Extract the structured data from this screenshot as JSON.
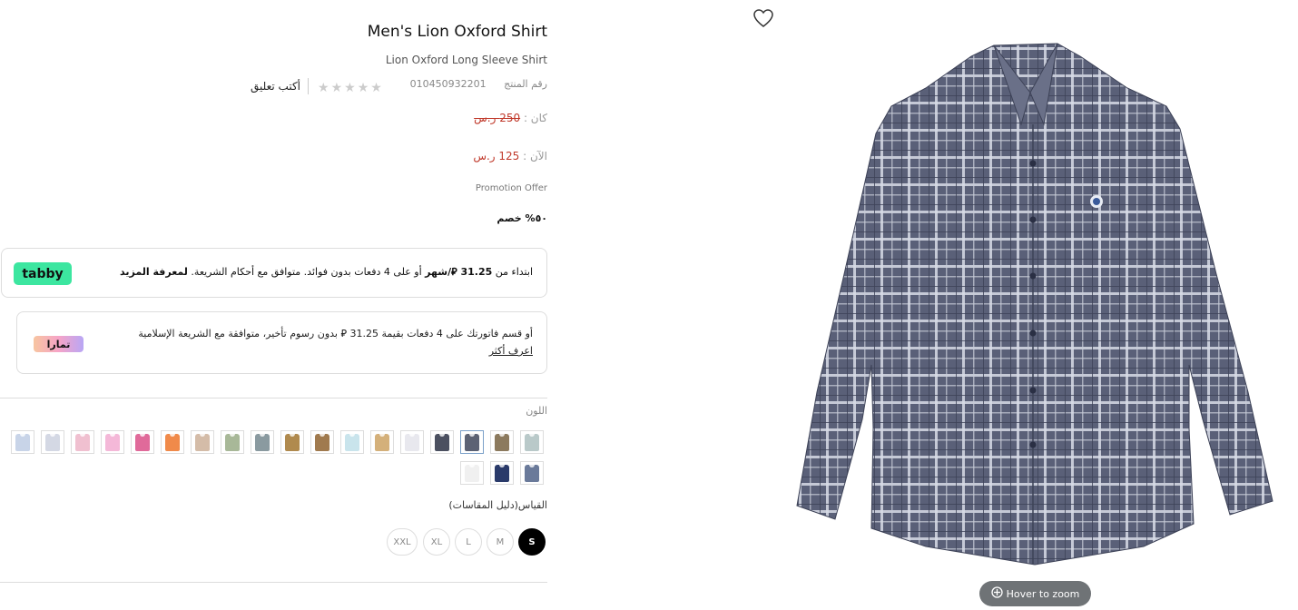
{
  "product": {
    "title": "Men's Lion Oxford Shirt",
    "subtitle": "Lion Oxford Long Sleeve Shirt",
    "sku_label": "رقم المنتج",
    "sku": "010450932201",
    "write_review": "أكتب تعليق",
    "rating": 0,
    "rating_max": 5
  },
  "pricing": {
    "was_label": "كان :",
    "was_price": "250 ر.س",
    "now_label": "الآن :",
    "now_price": "125 ر.س",
    "promo_label": "Promotion Offer",
    "discount": "٥٠% خصم"
  },
  "tabby": {
    "text_start": "ابتداء من",
    "amount": "31.25",
    "currency_symbol": "⃁",
    "per_month": "/شهر",
    "text_mid": "أو على 4 دفعات بدون فوائد. متوافق مع أحكام الشريعة.",
    "learn_more": "لمعرفة المزيد",
    "logo": "tabby"
  },
  "tamara": {
    "text": "أو قسم فاتورتك على 4 دفعات بقيمة 31.25 ⃁ بدون رسوم تأخير، متوافقة مع الشريعة الإسلامية",
    "learn_more": "اعرف أكثر",
    "logo": "تمارا"
  },
  "colors": {
    "label": "اللون",
    "swatches": [
      "#b9c9c9",
      "#8c7a5e",
      "#5c6274",
      "#4b5060",
      "#e8e8ee",
      "#d4b07a",
      "#c9e4ec",
      "#a07a4e",
      "#b08a4e",
      "#8a9aa0",
      "#a8b898",
      "#d4bca8",
      "#f08a4a",
      "#e06a9a",
      "#f4b8d8",
      "#f0c0d0",
      "#d4d8e4",
      "#c8d4e8",
      "#6a7a9a",
      "#2a3a6a",
      "#f0f0f0"
    ],
    "selected_index": 2
  },
  "sizes": {
    "label": "القياس",
    "guide": "(دليل المقاسات)",
    "options": [
      "S",
      "M",
      "L",
      "XL",
      "XXL"
    ],
    "selected": "S"
  },
  "image": {
    "zoom_hint": "Hover to zoom",
    "shirt_color": "#5a6078"
  }
}
